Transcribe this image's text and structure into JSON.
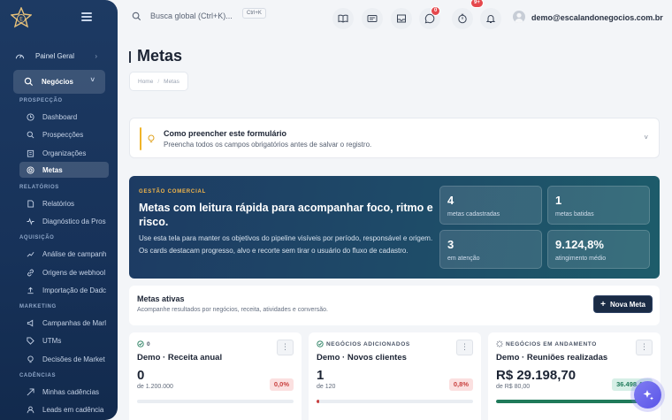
{
  "sidebar": {
    "top_item": "Painel Geral",
    "active_group": "Negócios",
    "sections": [
      {
        "title": "PROSPECÇÃO",
        "items": [
          "Dashboard",
          "Prospecções",
          "Organizações",
          "Metas"
        ]
      },
      {
        "title": "RELATÓRIOS",
        "items": [
          "Relatórios",
          "Diagnóstico da Pros"
        ]
      },
      {
        "title": "AQUISIÇÃO",
        "items": [
          "Análise de campanh",
          "Origens de webhool",
          "Importação de Dadc"
        ]
      },
      {
        "title": "MARKETING",
        "items": [
          "Campanhas de Marl",
          "UTMs",
          "Decisões de Market"
        ]
      },
      {
        "title": "CADÊNCIAS",
        "items": [
          "Minhas cadências",
          "Leads em cadência"
        ]
      }
    ],
    "active_item": "Metas"
  },
  "topbar": {
    "search_placeholder": "Busca global (Ctrl+K)...",
    "shortcut": "Ctrl+K",
    "whatsapp_badge": "0",
    "alerts_badge": "9+",
    "user_email": "demo@escalandonegocios.com.br"
  },
  "page": {
    "title": "Metas",
    "breadcrumb": [
      "Home",
      "Metas"
    ]
  },
  "help": {
    "title": "Como preencher este formulário",
    "text": "Preencha todos os campos obrigatórios antes de salvar o registro."
  },
  "hero": {
    "tag": "GESTÃO COMERCIAL",
    "title": "Metas com leitura rápida para acompanhar foco, ritmo e risco.",
    "text": "Use esta tela para manter os objetivos do pipeline visíveis por período, responsável e origem. Os cards destacam progresso, alvo e recorte sem tirar o usuário do fluxo de cadastro.",
    "stats": [
      {
        "value": "4",
        "label": "metas cadastradas"
      },
      {
        "value": "1",
        "label": "metas batidas"
      },
      {
        "value": "3",
        "label": "em atenção"
      },
      {
        "value": "9.124,8%",
        "label": "atingimento médio"
      }
    ]
  },
  "goals": {
    "title": "Metas ativas",
    "subtitle": "Acompanhe resultados por negócios, receita, atividades e conversão.",
    "new_button": "Nova Meta",
    "cards": [
      {
        "kind": "0",
        "name": "Demo · Receita anual",
        "value": "0",
        "target": "de 1.200.000",
        "percent": "0,0%",
        "progress": 0.0,
        "status": "red"
      },
      {
        "kind": "NEGÓCIOS ADICIONADOS",
        "name": "Demo · Novos clientes",
        "value": "1",
        "target": "de 120",
        "percent": "0,8%",
        "progress": 0.008,
        "status": "red"
      },
      {
        "kind": "NEGÓCIOS EM ANDAMENTO",
        "name": "Demo · Reuniões realizadas",
        "value": "R$ 29.198,70",
        "target": "de R$ 80,00",
        "percent": "36.498,4%",
        "progress": 1.0,
        "status": "green"
      }
    ]
  },
  "colors": {
    "sidebar": "#1d3a63",
    "accent_yellow": "#f0b429",
    "danger": "#c9403f",
    "success": "#1f7a5a",
    "fab": "#6b66ee"
  }
}
